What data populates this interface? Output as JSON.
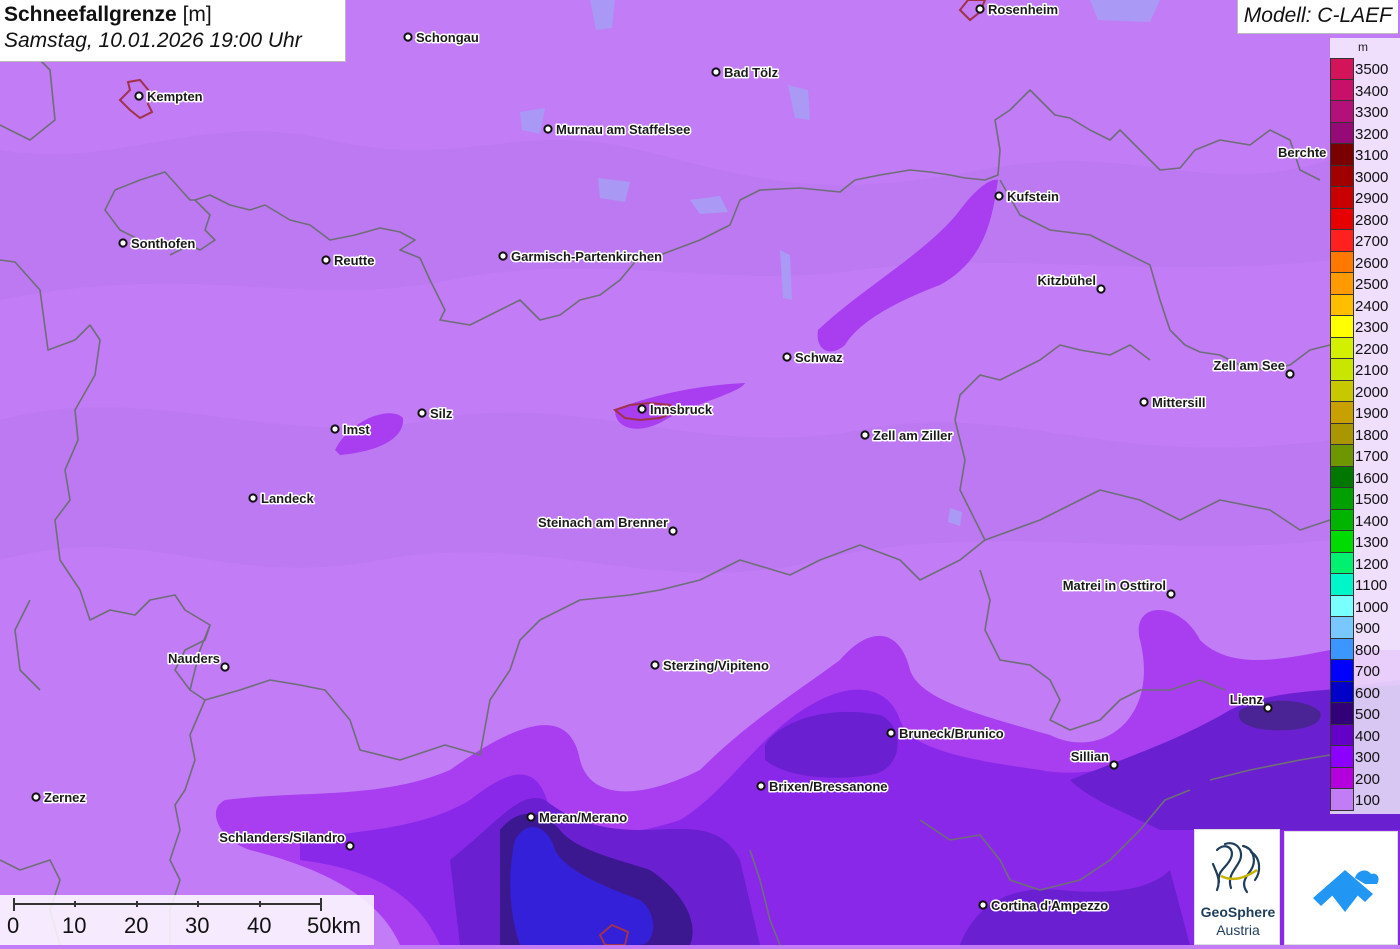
{
  "header": {
    "title": "Schneefallgrenze",
    "unit": "[m]",
    "date": "Samstag, 10.01.2026 19:00 Uhr"
  },
  "model": "Modell: C-LAEF",
  "legend": {
    "unit": "m",
    "items": [
      {
        "label": "3500",
        "color": "#d4145a"
      },
      {
        "label": "3400",
        "color": "#c8106a"
      },
      {
        "label": "3300",
        "color": "#b4107a"
      },
      {
        "label": "3200",
        "color": "#960a78"
      },
      {
        "label": "3100",
        "color": "#7a0000"
      },
      {
        "label": "3000",
        "color": "#a00000"
      },
      {
        "label": "2900",
        "color": "#c80000"
      },
      {
        "label": "2800",
        "color": "#e60000"
      },
      {
        "label": "2700",
        "color": "#ff2020"
      },
      {
        "label": "2600",
        "color": "#ff7800"
      },
      {
        "label": "2500",
        "color": "#ff9a00"
      },
      {
        "label": "2400",
        "color": "#ffbe00"
      },
      {
        "label": "2300",
        "color": "#ffff00"
      },
      {
        "label": "2200",
        "color": "#d2f000"
      },
      {
        "label": "2100",
        "color": "#c8e600"
      },
      {
        "label": "2000",
        "color": "#c8c800"
      },
      {
        "label": "1900",
        "color": "#c8a000"
      },
      {
        "label": "1800",
        "color": "#aa9600"
      },
      {
        "label": "1700",
        "color": "#6e9600"
      },
      {
        "label": "1600",
        "color": "#007800"
      },
      {
        "label": "1500",
        "color": "#00a000"
      },
      {
        "label": "1400",
        "color": "#00b400"
      },
      {
        "label": "1300",
        "color": "#00dc00"
      },
      {
        "label": "1200",
        "color": "#00f070"
      },
      {
        "label": "1100",
        "color": "#00f5c8"
      },
      {
        "label": "1000",
        "color": "#7affff"
      },
      {
        "label": "900",
        "color": "#78c8ff"
      },
      {
        "label": "800",
        "color": "#3c96ff"
      },
      {
        "label": "700",
        "color": "#0000ff"
      },
      {
        "label": "600",
        "color": "#0000c8"
      },
      {
        "label": "500",
        "color": "#320078"
      },
      {
        "label": "400",
        "color": "#6400c8"
      },
      {
        "label": "300",
        "color": "#8c00ff"
      },
      {
        "label": "200",
        "color": "#b400dc"
      },
      {
        "label": "100",
        "color": "#c27cf6"
      }
    ]
  },
  "cities": [
    {
      "name": "Rosenheim"
    },
    {
      "name": "Schongau"
    },
    {
      "name": "Kempten"
    },
    {
      "name": "Bad Tölz"
    },
    {
      "name": "Murnau am Staffelsee"
    },
    {
      "name": "Berchte"
    },
    {
      "name": "Kufstein"
    },
    {
      "name": "Sonthofen"
    },
    {
      "name": "Reutte"
    },
    {
      "name": "Garmisch-Partenkirchen"
    },
    {
      "name": "Kitzbühel"
    },
    {
      "name": "Schwaz"
    },
    {
      "name": "Zell am See"
    },
    {
      "name": "Mittersill"
    },
    {
      "name": "Imst"
    },
    {
      "name": "Silz"
    },
    {
      "name": "Innsbruck"
    },
    {
      "name": "Zell am Ziller"
    },
    {
      "name": "Landeck"
    },
    {
      "name": "Steinach am Brenner"
    },
    {
      "name": "Matrei in Osttirol"
    },
    {
      "name": "Nauders"
    },
    {
      "name": "Sterzing/Vipiteno"
    },
    {
      "name": "Lienz"
    },
    {
      "name": "Bruneck/Brunico"
    },
    {
      "name": "Sillian"
    },
    {
      "name": "Brixen/Bressanone"
    },
    {
      "name": "Zernez"
    },
    {
      "name": "Meran/Merano"
    },
    {
      "name": "Schlanders/Silandro"
    },
    {
      "name": "Cortina d'Ampezzo"
    }
  ],
  "scale": {
    "labels": [
      "0",
      "10",
      "20",
      "30",
      "40",
      "50km"
    ]
  },
  "logos": {
    "geosphere_name": "GeoSphere",
    "geosphere_sub": "Austria"
  },
  "colors": {
    "background_field": "#c27cf6",
    "border_line": "#6e6e78",
    "city_outline": "#a0324b"
  }
}
